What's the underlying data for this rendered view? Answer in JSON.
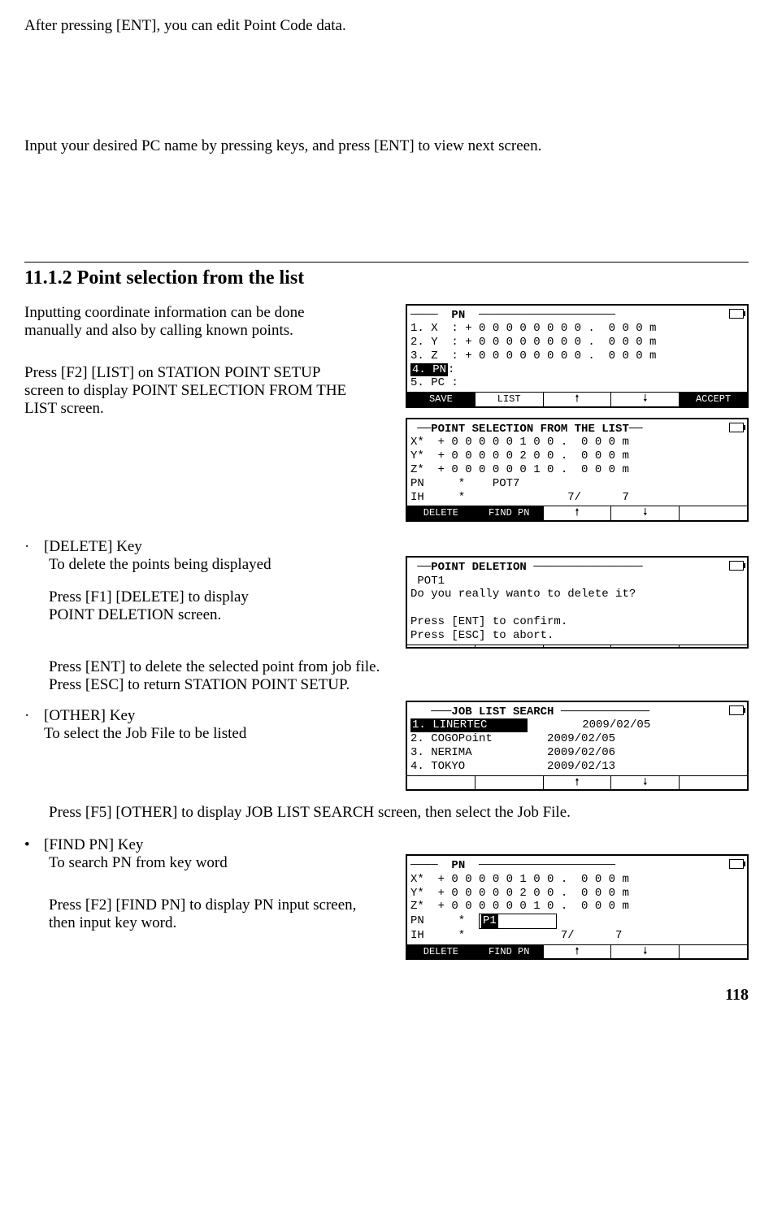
{
  "intro1": "After pressing [ENT], you can edit Point Code data.",
  "intro2": "Input your desired PC name by pressing keys, and press [ENT] to view next screen.",
  "heading": "11.1.2 Point selection from the list",
  "p1a": "Inputting coordinate information can be done",
  "p1b": "manually and also by calling known points.",
  "p2a": "Press [F2] [LIST] on STATION POINT SETUP",
  "p2b": "screen to display POINT SELECTION FROM THE",
  "p2c": "LIST screen.",
  "lcd1": {
    "title": " PN ",
    "r1": "1. X  : + 0 0 0 0 0 0 0 0 .  0 0 0 m",
    "r2": "2. Y  : + 0 0 0 0 0 0 0 0 .  0 0 0 m",
    "r3": "3. Z  : + 0 0 0 0 0 0 0 0 .  0 0 0 m",
    "r4": "4. PN",
    "r4b": ":",
    "r5": "5. PC :",
    "sk": [
      "SAVE",
      "LIST",
      "🠕",
      "🠗",
      "ACCEPT"
    ]
  },
  "lcd2": {
    "title": "POINT SELECTION FROM THE LIST",
    "r1": "X*  + 0 0 0 0 0 1 0 0 .  0 0 0 m",
    "r2": "Y*  + 0 0 0 0 0 2 0 0 .  0 0 0 m",
    "r3": "Z*  + 0 0 0 0 0 0 1 0 .  0 0 0 m",
    "r4": "PN     *    POT7",
    "r5": "IH     *               7/      7",
    "sk": [
      "DELETE",
      "FIND PN",
      "🠕",
      "🠗",
      ""
    ]
  },
  "delete_head": "[DELETE] Key",
  "delete_l1": "To delete the points being displayed",
  "delete_l2": "Press [F1] [DELETE] to display",
  "delete_l3": "POINT DELETION screen.",
  "lcd3": {
    "title": "POINT DELETION",
    "r1": " POT1",
    "r2": "Do you really wanto to delete it?",
    "r3": "Press [ENT] to confirm.",
    "r4": "Press [ESC] to abort.",
    "sk": [
      "",
      "",
      "",
      "",
      ""
    ]
  },
  "delete_l4": "Press [ENT] to delete the selected point from job file.",
  "delete_l5": "Press [ESC] to return STATION POINT SETUP.",
  "other_head": "[OTHER] Key",
  "other_l1": "To select the Job File to be listed",
  "lcd4": {
    "title": "JOB LIST SEARCH",
    "r1a": "1. LINERTEC",
    "r1b": "2009/02/05",
    "r2a": "2. COGOPoint",
    "r2b": "2009/02/05",
    "r3a": "3. NERIMA",
    "r3b": "2009/02/06",
    "r4a": "4. TOKYO",
    "r4b": "2009/02/13",
    "sk": [
      "",
      "",
      "🠕",
      "🠗",
      ""
    ]
  },
  "other_l2": "Press [F5] [OTHER] to display JOB LIST SEARCH screen, then select the Job File.",
  "find_head": "[FIND PN] Key",
  "find_l1": "To search PN from key word",
  "find_l2": "Press [F2] [FIND PN] to display PN input screen,",
  "find_l3": "then input key word.",
  "lcd5": {
    "title": " PN ",
    "r1": "X*  + 0 0 0 0 0 1 0 0 .  0 0 0 m",
    "r2": "Y*  + 0 0 0 0 0 2 0 0 .  0 0 0 m",
    "r3": "Z*  + 0 0 0 0 0 0 1 0 .  0 0 0 m",
    "r4a": "PN     *  ",
    "r4b": "P1",
    "r5": "IH     *              7/      7",
    "sk": [
      "DELETE",
      "FIND PN",
      "🠕",
      "🠗",
      ""
    ]
  },
  "page": "118"
}
